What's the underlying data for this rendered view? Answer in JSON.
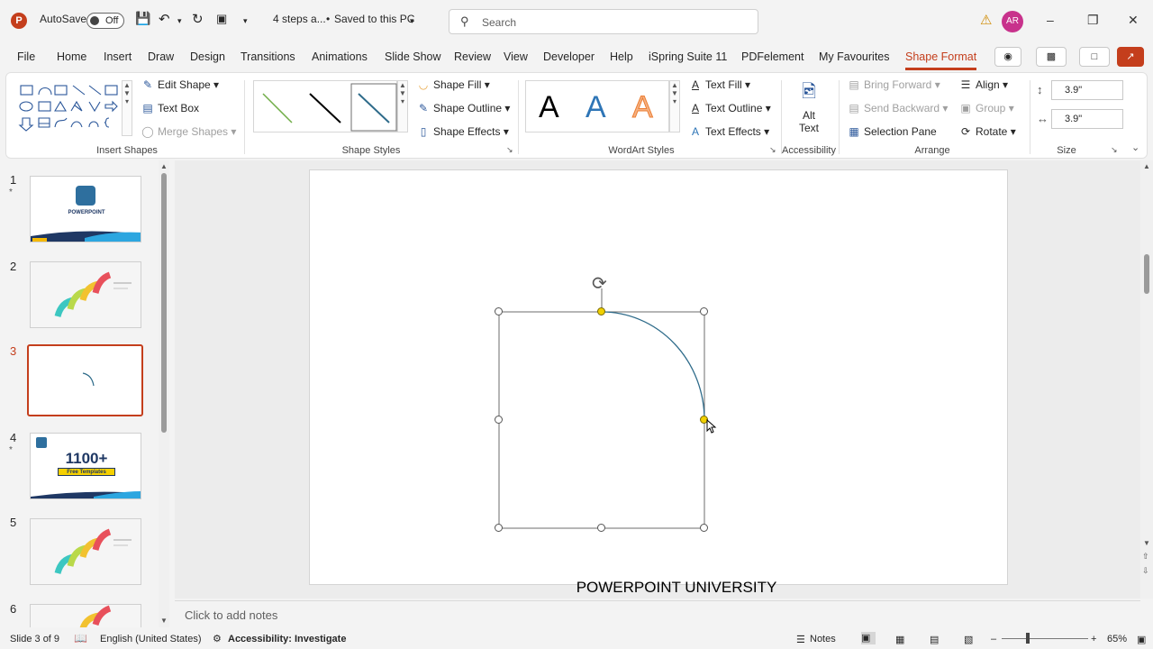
{
  "titlebar": {
    "app_icon": "P",
    "autosave_label": "AutoSave",
    "autosave_state": "Off",
    "doc_title": "4 steps a...",
    "save_status": "Saved to this PC",
    "search_placeholder": "Search",
    "avatar_initials": "AR",
    "warning_icon": "warning-icon"
  },
  "tabs": [
    "File",
    "Home",
    "Insert",
    "Draw",
    "Design",
    "Transitions",
    "Animations",
    "Slide Show",
    "Review",
    "View",
    "Developer",
    "Help",
    "iSpring Suite 11",
    "PDFelement",
    "My Favourites",
    "Shape Format"
  ],
  "active_tab": "Shape Format",
  "ribbon": {
    "insert_shapes": {
      "label": "Insert Shapes",
      "edit_shape": "Edit Shape",
      "text_box": "Text Box",
      "merge_shapes": "Merge Shapes"
    },
    "shape_styles": {
      "label": "Shape Styles",
      "shape_fill": "Shape Fill",
      "shape_outline": "Shape Outline",
      "shape_effects": "Shape Effects"
    },
    "wordart_styles": {
      "label": "WordArt Styles",
      "sample": "A",
      "text_fill": "Text Fill",
      "text_outline": "Text Outline",
      "text_effects": "Text Effects"
    },
    "accessibility": {
      "label": "Accessibility",
      "alt_text_1": "Alt",
      "alt_text_2": "Text"
    },
    "arrange": {
      "label": "Arrange",
      "bring_forward": "Bring Forward",
      "send_backward": "Send Backward",
      "selection_pane": "Selection Pane",
      "align": "Align",
      "group": "Group",
      "rotate": "Rotate"
    },
    "size": {
      "label": "Size",
      "height": "3.9\"",
      "width": "3.9\""
    }
  },
  "slides": [
    {
      "num": "1",
      "star": "*"
    },
    {
      "num": "2",
      "star": ""
    },
    {
      "num": "3",
      "star": ""
    },
    {
      "num": "4",
      "star": "*",
      "big_text": "1100+",
      "sub_text": "Free Templates"
    },
    {
      "num": "5",
      "star": ""
    },
    {
      "num": "6",
      "star": ""
    }
  ],
  "thumb1_text": "POWERPOINT",
  "slide_footer": "POWERPOINT UNIVERSITY",
  "notes_placeholder": "Click to add notes",
  "statusbar": {
    "slide_info": "Slide 3 of 9",
    "language": "English (United States)",
    "accessibility": "Accessibility: Investigate",
    "notes": "Notes",
    "zoom": "65%"
  },
  "colors": {
    "accent": "#c43e1c",
    "arc": "#2e6b8a",
    "handle_yellow": "#f0d000"
  }
}
